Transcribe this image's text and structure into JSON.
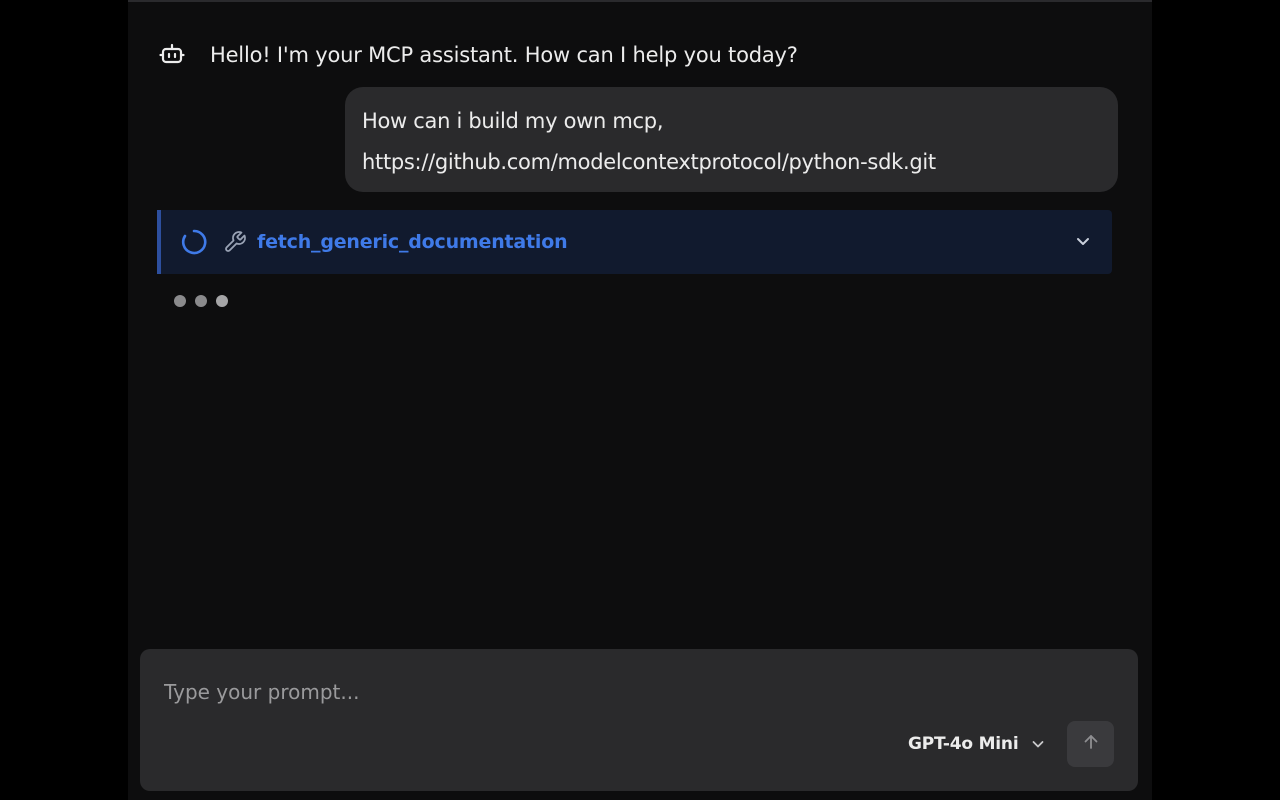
{
  "messages": {
    "assistant_greeting": "Hello! I'm your MCP assistant. How can I help you today?",
    "user_line1": "How can i build my own mcp,",
    "user_line2": "https://github.com/modelcontextprotocol/python-sdk.git"
  },
  "tool_call": {
    "name": "fetch_generic_documentation",
    "status": "loading"
  },
  "composer": {
    "placeholder": "Type your prompt...",
    "value": "",
    "model": "GPT-4o Mini"
  },
  "icons": {
    "assistant": "robot-icon",
    "tool": "wrench-icon",
    "spinner": "loading-spinner-icon",
    "expand": "chevron-down-icon",
    "send": "arrow-up-icon"
  },
  "colors": {
    "panel_bg": "#0d0d0e",
    "bubble_bg": "#2a2a2c",
    "tool_bg": "#111a2e",
    "tool_accent": "#3f7ae8"
  }
}
